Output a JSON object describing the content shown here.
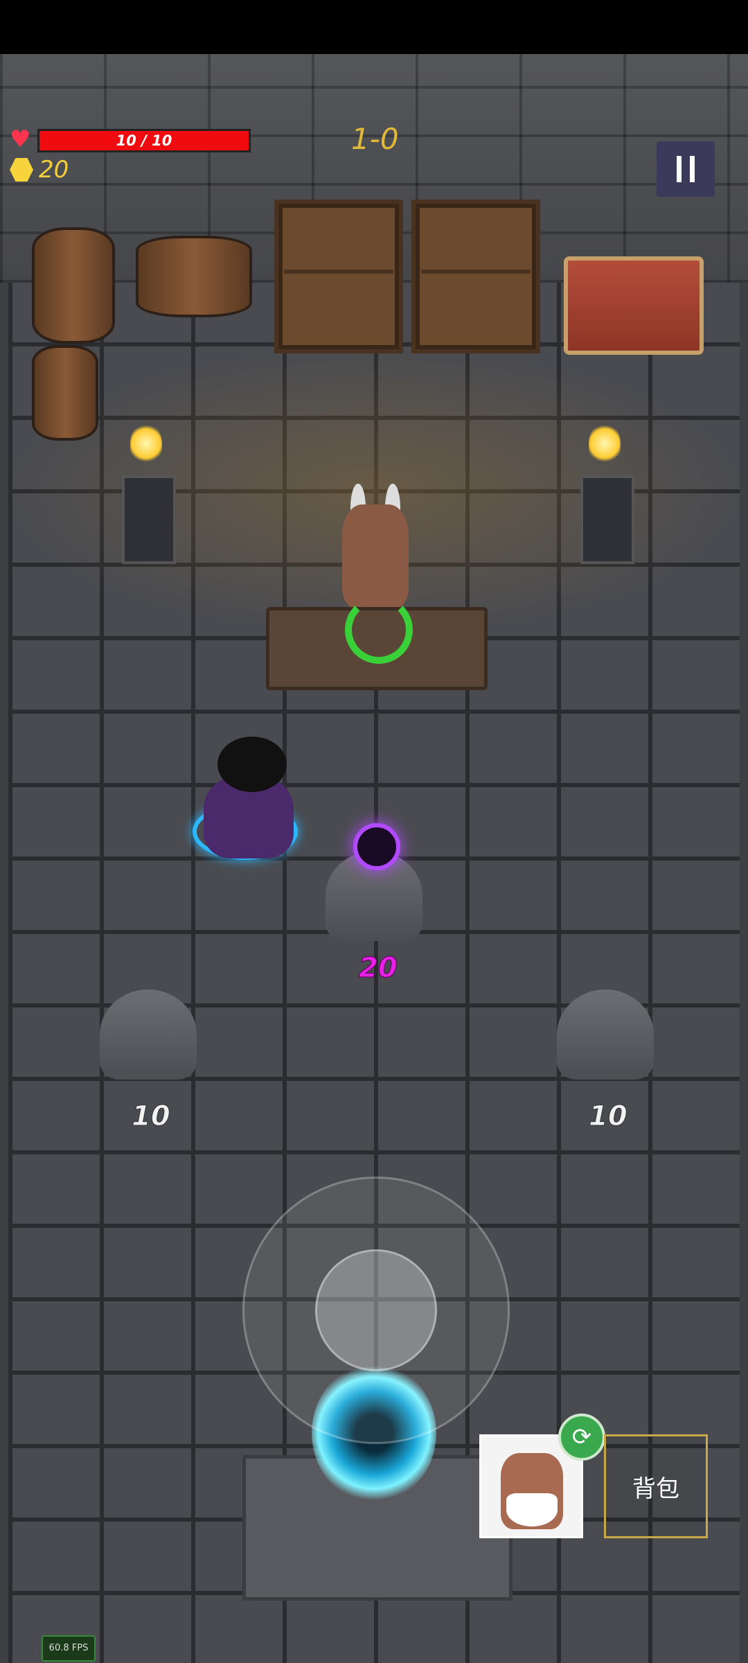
{
  "hud": {
    "hp_text": "10 / 10",
    "hp_fraction": 1.0,
    "coins": "20",
    "level": "1-0",
    "pause_icon": "pause-icon",
    "heart_icon": "heart-icon",
    "coin_icon": "coin-icon"
  },
  "shop": {
    "center_price": "20",
    "left_price": "10",
    "right_price": "10"
  },
  "bottom": {
    "bag_label": "背包",
    "swap_icon": "refresh-icon"
  },
  "debug": {
    "fps": "60.8 FPS"
  },
  "colors": {
    "hp": "#f00b10",
    "coin": "#f3cd3e",
    "level": "#e3b93a",
    "rare_price": "#e620e6",
    "player_ring": "#2db7ff",
    "portal": "#1aa7d8"
  }
}
